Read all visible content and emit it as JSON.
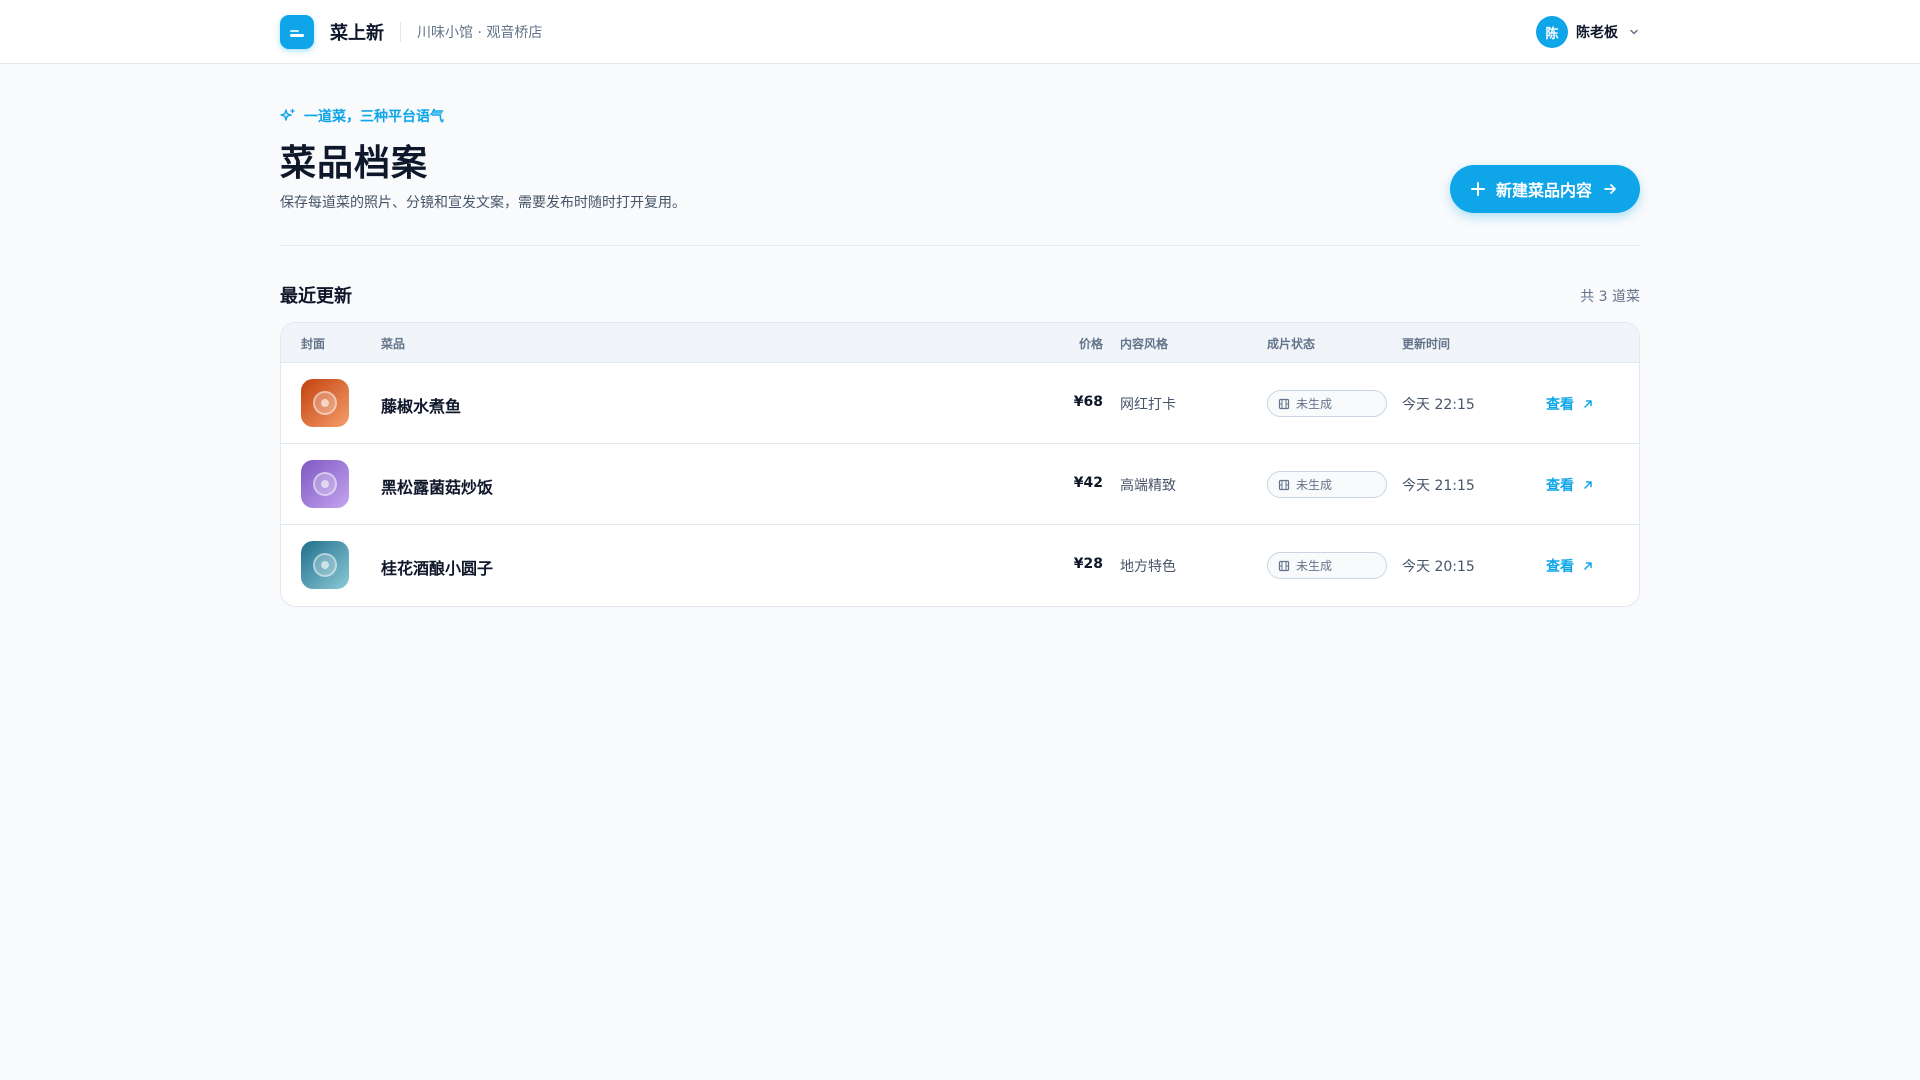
{
  "header": {
    "app_name": "菜上新",
    "store_name": "川味小馆 · 观音桥店",
    "user_initial": "陈",
    "user_name": "陈老板"
  },
  "hero": {
    "eyebrow": "一道菜，三种平台语气",
    "title": "菜品档案",
    "description": "保存每道菜的照片、分镜和宣发文案，需要发布时随时打开复用。",
    "new_button_label": "新建菜品内容"
  },
  "list": {
    "title": "最近更新",
    "count_text": "共 3 道菜",
    "columns": [
      "封面",
      "菜品",
      "价格",
      "内容风格",
      "成片状态",
      "更新时间"
    ],
    "rows": [
      {
        "name": "藤椒水煮鱼",
        "price": "¥68",
        "style": "网红打卡",
        "status": "未生成",
        "updated": "今天 22:15",
        "action": "查看",
        "cover_from": "#c2410c",
        "cover_to": "#f59e6b"
      },
      {
        "name": "黑松露菌菇炒饭",
        "price": "¥42",
        "style": "高端精致",
        "status": "未生成",
        "updated": "今天 21:15",
        "action": "查看",
        "cover_from": "#7e57c2",
        "cover_to": "#c4a5ef"
      },
      {
        "name": "桂花酒酿小圆子",
        "price": "¥28",
        "style": "地方特色",
        "status": "未生成",
        "updated": "今天 20:15",
        "action": "查看",
        "cover_from": "#1f6f8b",
        "cover_to": "#8cc9d6"
      }
    ]
  },
  "colors": {
    "accent": "#0ea5e9",
    "text": "#0f172a",
    "muted": "#64748b"
  }
}
